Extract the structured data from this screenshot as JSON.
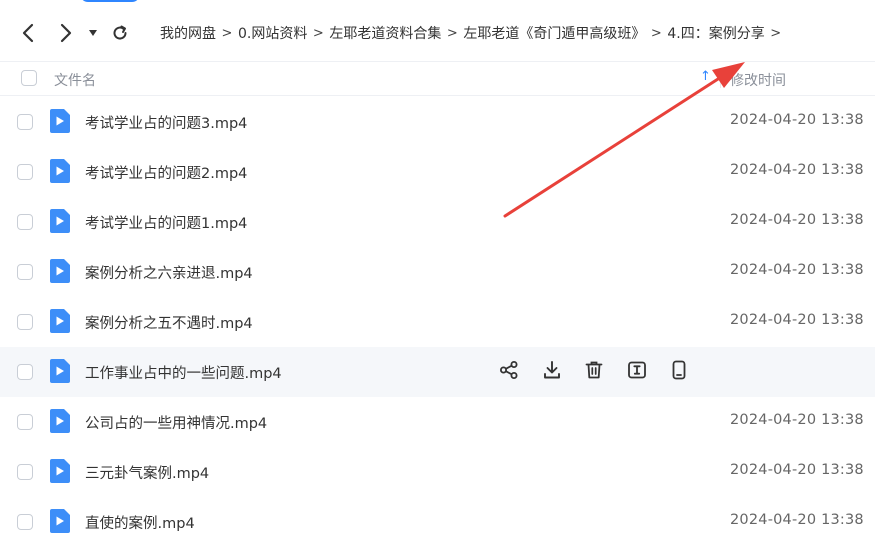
{
  "breadcrumb": [
    "我的网盘",
    "0.网站资料",
    "左耶老道资料合集",
    "左耶老道《奇门遁甲高级班》",
    "4.四：案例分享"
  ],
  "header": {
    "name_label": "文件名",
    "time_label": "修改时间"
  },
  "files": [
    {
      "name": "考试学业占的问题3.mp4",
      "time": "2024-04-20 13:38"
    },
    {
      "name": "考试学业占的问题2.mp4",
      "time": "2024-04-20 13:38"
    },
    {
      "name": "考试学业占的问题1.mp4",
      "time": "2024-04-20 13:38"
    },
    {
      "name": "案例分析之六亲进退.mp4",
      "time": "2024-04-20 13:38"
    },
    {
      "name": "案例分析之五不遇时.mp4",
      "time": "2024-04-20 13:38"
    },
    {
      "name": "工作事业占中的一些问题.mp4",
      "time": ""
    },
    {
      "name": "公司占的一些用神情况.mp4",
      "time": "2024-04-20 13:38"
    },
    {
      "name": "三元卦气案例.mp4",
      "time": "2024-04-20 13:38"
    },
    {
      "name": "直使的案例.mp4",
      "time": "2024-04-20 13:38"
    }
  ],
  "row_actions": [
    "share-icon",
    "download-icon",
    "delete-icon",
    "rename-icon",
    "phone-icon"
  ],
  "colors": {
    "accent": "#2f86ff",
    "annotation_arrow": "#e8413a",
    "video_icon": "#3d8ef8"
  }
}
